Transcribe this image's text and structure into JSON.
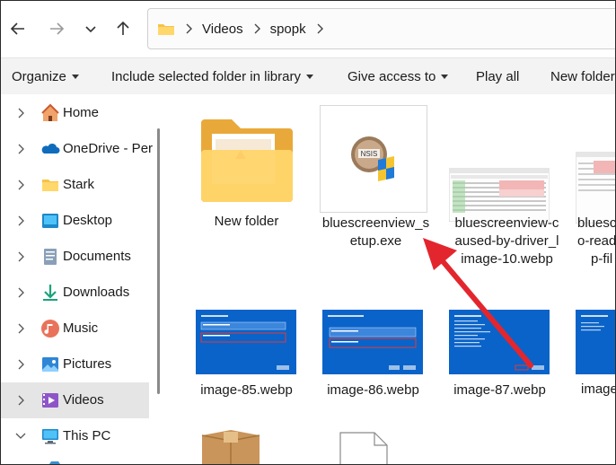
{
  "breadcrumb": {
    "segments": [
      "Videos",
      "spopk"
    ]
  },
  "commands": [
    {
      "label": "Organize",
      "caret": true
    },
    {
      "label": "Include selected folder in library",
      "caret": true
    },
    {
      "label": "Give access to",
      "caret": true
    },
    {
      "label": "Play all",
      "caret": false
    },
    {
      "label": "New folder",
      "caret": false
    }
  ],
  "sidebar": {
    "items": [
      {
        "label": "Home",
        "icon": "home-icon",
        "selected": false
      },
      {
        "label": "OneDrive - Per",
        "icon": "onedrive-cloud-icon",
        "selected": false
      },
      {
        "label": "Stark",
        "icon": "folder-icon",
        "selected": false
      },
      {
        "label": "Desktop",
        "icon": "desktop-icon",
        "selected": false
      },
      {
        "label": "Documents",
        "icon": "documents-icon",
        "selected": false
      },
      {
        "label": "Downloads",
        "icon": "downloads-icon",
        "selected": false
      },
      {
        "label": "Music",
        "icon": "music-icon",
        "selected": false
      },
      {
        "label": "Pictures",
        "icon": "pictures-icon",
        "selected": false
      },
      {
        "label": "Videos",
        "icon": "videos-icon",
        "selected": true
      },
      {
        "label": "This PC",
        "icon": "this-pc-icon",
        "selected": false
      }
    ]
  },
  "files": [
    {
      "line1": "New folder",
      "line2": "",
      "kind": "folder"
    },
    {
      "line1": "bluescreenview_s",
      "line2": "etup.exe",
      "kind": "installer"
    },
    {
      "line1": "bluescreenview-c",
      "line2": "aused-by-driver_l",
      "line3": "image-10.webp",
      "kind": "screenshot"
    },
    {
      "line1": "bluescre",
      "line2": "o-read",
      "line3": "p-fil",
      "kind": "screenshot"
    },
    {
      "line1": "image-85.webp",
      "kind": "bluedialog"
    },
    {
      "line1": "image-86.webp",
      "kind": "bluedialog"
    },
    {
      "line1": "image-87.webp",
      "kind": "bluedialog"
    },
    {
      "line1": "image",
      "kind": "bluedialog"
    }
  ],
  "colors": {
    "accent": "#0063b1",
    "arrow": "#e3262d",
    "folder": "#f7c24a"
  }
}
